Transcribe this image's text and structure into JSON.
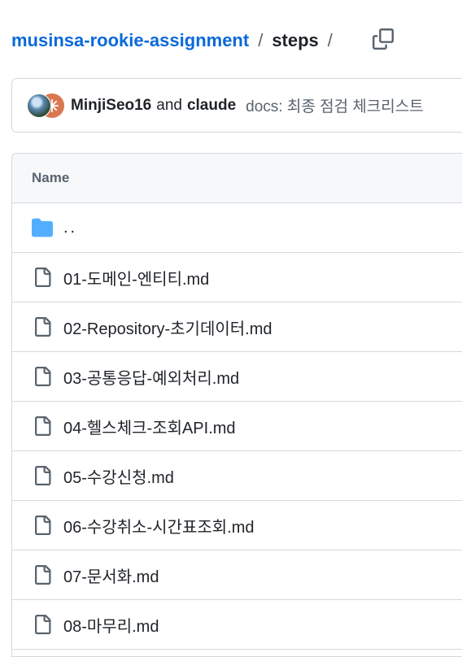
{
  "breadcrumb": {
    "repo": "musinsa-rookie-assignment",
    "separator": "/",
    "directory": "steps",
    "trailing_separator": "/"
  },
  "commit": {
    "author1": "MinjiSeo16",
    "conjunction": "and",
    "author2": "claude",
    "message": "docs: 최종 점검 체크리스트"
  },
  "table": {
    "header": "Name",
    "parent_dir": "..",
    "files": [
      "01-도메인-엔티티.md",
      "02-Repository-초기데이터.md",
      "03-공통응답-예외처리.md",
      "04-헬스체크-조회API.md",
      "05-수강신청.md",
      "06-수강취소-시간표조회.md",
      "07-문서화.md",
      "08-마무리.md"
    ]
  },
  "icons": {
    "copy": "copy-icon",
    "folder": "folder-icon",
    "file": "file-icon"
  },
  "colors": {
    "link": "#0969da",
    "folder": "#54aeff",
    "muted": "#59636e",
    "border": "#d1d9e0"
  }
}
